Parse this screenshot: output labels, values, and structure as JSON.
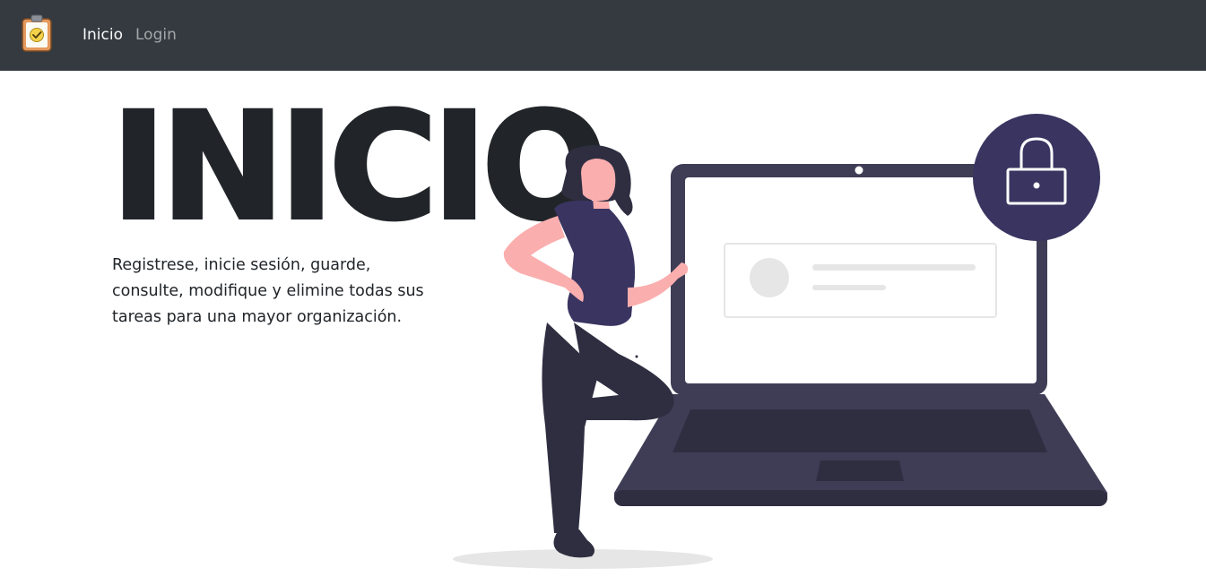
{
  "navbar": {
    "brand_icon": "clipboard-check-icon",
    "links": [
      {
        "label": "Inicio",
        "active": true
      },
      {
        "label": "Login",
        "active": false
      }
    ]
  },
  "hero": {
    "title": "INICIO",
    "description": "Registrese, inicie sesión, guarde, consulte, modifique y elimine todas sus tareas para una mayor organización."
  },
  "illustration": {
    "subject": "woman-leaning-on-laptop-with-lock",
    "icons": [
      "lock-icon",
      "avatar-placeholder-icon"
    ]
  },
  "colors": {
    "navbar": "#343a40",
    "text": "#212529",
    "laptop": "#3f3d56",
    "accent": "#393460",
    "skin": "#fbaeae"
  }
}
